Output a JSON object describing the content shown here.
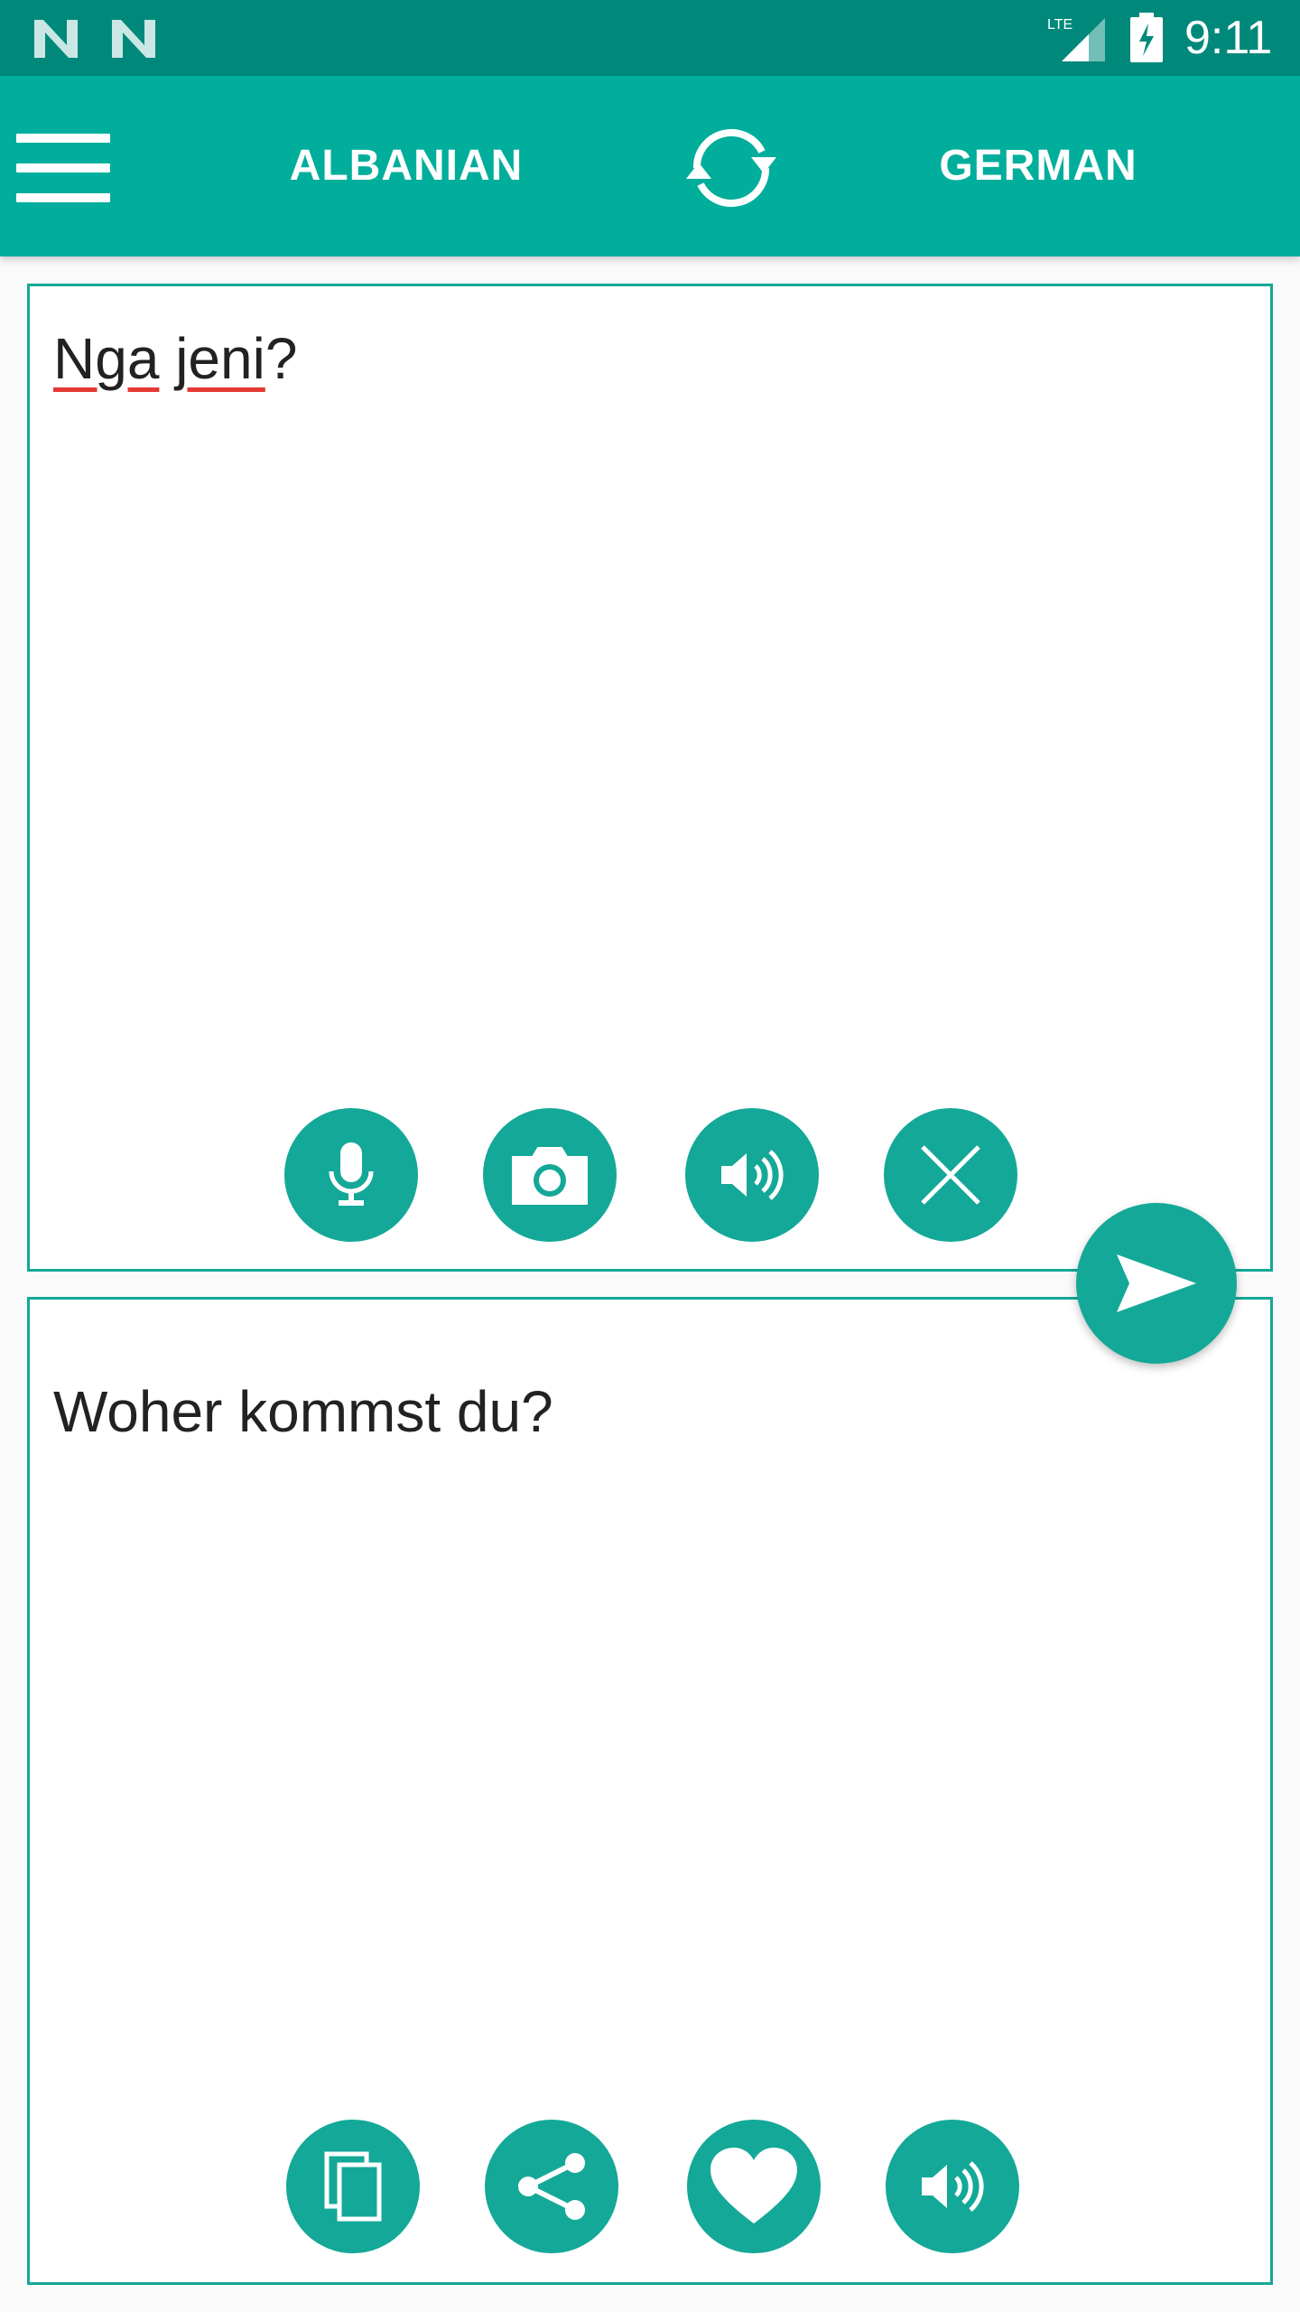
{
  "status_bar": {
    "time": "9:11",
    "network_label": "LTE",
    "icons": [
      "n-notification-icon",
      "n-notification-icon",
      "lte-signal-icon",
      "battery-charging-icon"
    ]
  },
  "app_bar": {
    "source_language": "ALBANIAN",
    "target_language": "GERMAN",
    "icons": [
      "menu-icon",
      "swap-languages-icon"
    ]
  },
  "input": {
    "words": [
      "Nga",
      "jeni"
    ],
    "punctuation": "?",
    "misspelled": [
      "Nga",
      "jeni"
    ],
    "buttons": [
      "microphone-icon",
      "camera-icon",
      "speaker-icon",
      "close-icon"
    ]
  },
  "translate_button": {
    "icon": "send-icon"
  },
  "output": {
    "text": "Woher kommst du?",
    "buttons": [
      "copy-icon",
      "share-icon",
      "heart-icon",
      "speaker-icon"
    ]
  },
  "colors": {
    "status_bar": "#00897b",
    "app_bar": "#00ae9b",
    "accent": "#14a898",
    "spellcheck": "#e53935"
  }
}
